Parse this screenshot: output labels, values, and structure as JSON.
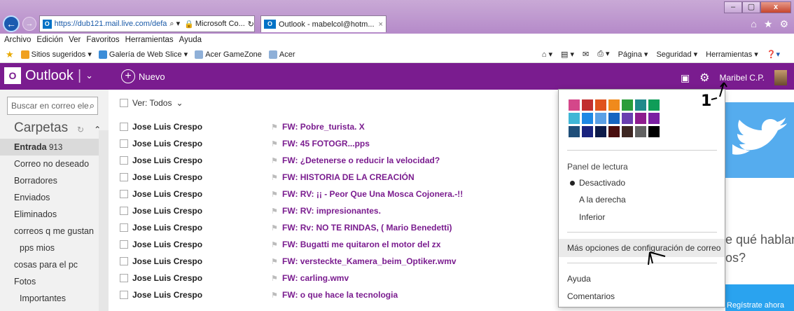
{
  "browser": {
    "address_url": "https://dub121.mail.live.com/defa",
    "address_site": "Microsoft Co...",
    "tab_title": "Outlook - mabelcol@hotm...",
    "menu": [
      "Archivo",
      "Edición",
      "Ver",
      "Favoritos",
      "Herramientas",
      "Ayuda"
    ],
    "favorites": [
      "Sitios sugeridos ▾",
      "Galería de Web Slice ▾",
      "Acer GameZone",
      "Acer"
    ],
    "commands": [
      "Página ▾",
      "Seguridad ▾",
      "Herramientas ▾"
    ]
  },
  "outlook": {
    "logo": "Outlook",
    "new_label": "Nuevo",
    "user_name": "Maribel C.P."
  },
  "sidebar": {
    "search_placeholder": "Buscar en correo ele",
    "carpetas": "Carpetas",
    "folders": [
      {
        "label": "Entrada",
        "count": "913"
      },
      {
        "label": "Correo no deseado"
      },
      {
        "label": "Borradores"
      },
      {
        "label": "Enviados"
      },
      {
        "label": "Eliminados"
      },
      {
        "label": "correos q me gustan"
      },
      {
        "label": "pps mios"
      },
      {
        "label": "cosas para el pc"
      },
      {
        "label": "Fotos"
      },
      {
        "label": "Importantes"
      }
    ]
  },
  "list": {
    "filter": "Ver: Todos",
    "messages": [
      {
        "from": "Jose Luis Crespo",
        "subject": "FW: Pobre_turista. X"
      },
      {
        "from": "Jose Luis Crespo",
        "subject": "FW: 45 FOTOGR...pps"
      },
      {
        "from": "Jose Luis Crespo",
        "subject": "FW: ¿Detenerse o reducir la velocidad?"
      },
      {
        "from": "Jose Luis Crespo",
        "subject": "FW: HISTORIA DE LA CREACIÓN"
      },
      {
        "from": "Jose Luis Crespo",
        "subject": "FW: RV: ¡¡ - Peor Que Una Mosca Cojonera.-!!"
      },
      {
        "from": "Jose Luis Crespo",
        "subject": "FW: RV: impresionantes."
      },
      {
        "from": "Jose Luis Crespo",
        "subject": "FW: Rv: NO TE RINDAS, ( Mario Benedetti)"
      },
      {
        "from": "Jose Luis Crespo",
        "subject": "FW: Bugatti me quitaron el motor del zx"
      },
      {
        "from": "Jose Luis Crespo",
        "subject": "FW: versteckte_Kamera_beim_Optiker.wmv"
      },
      {
        "from": "Jose Luis Crespo",
        "subject": "FW: carling.wmv"
      },
      {
        "from": "Jose Luis Crespo",
        "subject": "FW: o que hace la tecnologia"
      }
    ]
  },
  "settings": {
    "swatch_colors": [
      "#d4478a",
      "#c13030",
      "#e0531d",
      "#f08a1c",
      "#2a9d3a",
      "#1f8a8a",
      "#0f9d58",
      "#3fb6d6",
      "#1e88e5",
      "#5aa0e6",
      "#1565c0",
      "#6a3fb0",
      "#8e1c8e",
      "#7b1fa2",
      "#1f4e79",
      "#1a237e",
      "#0d1b4a",
      "#4a0e0e",
      "#3e2723",
      "#616161",
      "#000000"
    ],
    "panel_title": "Panel de lectura",
    "panel_options": [
      "Desactivado",
      "A la derecha",
      "Inferior"
    ],
    "more_options": "Más opciones de configuración de correo",
    "help": "Ayuda",
    "comments": "Comentarios"
  },
  "promo": {
    "line1": "e qué hablan",
    "line2": "os?",
    "button": "Regístrate ahora"
  },
  "annotation": {
    "number": "1"
  }
}
